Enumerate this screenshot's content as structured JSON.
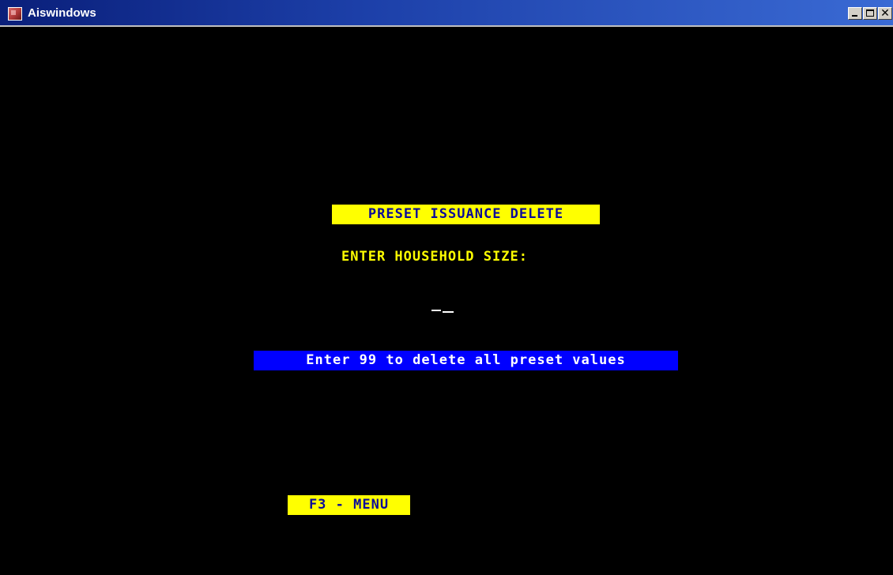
{
  "window": {
    "title": "Aiswindows",
    "controls": {
      "minimize_icon": "minimize-icon",
      "maximize_icon": "maximize-icon",
      "close_icon": "close-icon",
      "close_glyph": "✕"
    }
  },
  "screen": {
    "title": "PRESET ISSUANCE DELETE",
    "prompt": "ENTER HOUSEHOLD SIZE:",
    "household_size_value": "",
    "hint": "Enter 99 to delete all preset values",
    "function_keys": {
      "menu": "F3 - MENU"
    }
  },
  "colors": {
    "background": "#000000",
    "yellow_highlight": "#ffff00",
    "yellow_text": "#ffff00",
    "dark_blue_text": "#0a0a9a",
    "blue_highlight": "#0000ff",
    "white_text": "#ffffff",
    "titlebar_start": "#0a1f7a",
    "titlebar_end": "#3a6ad4"
  }
}
